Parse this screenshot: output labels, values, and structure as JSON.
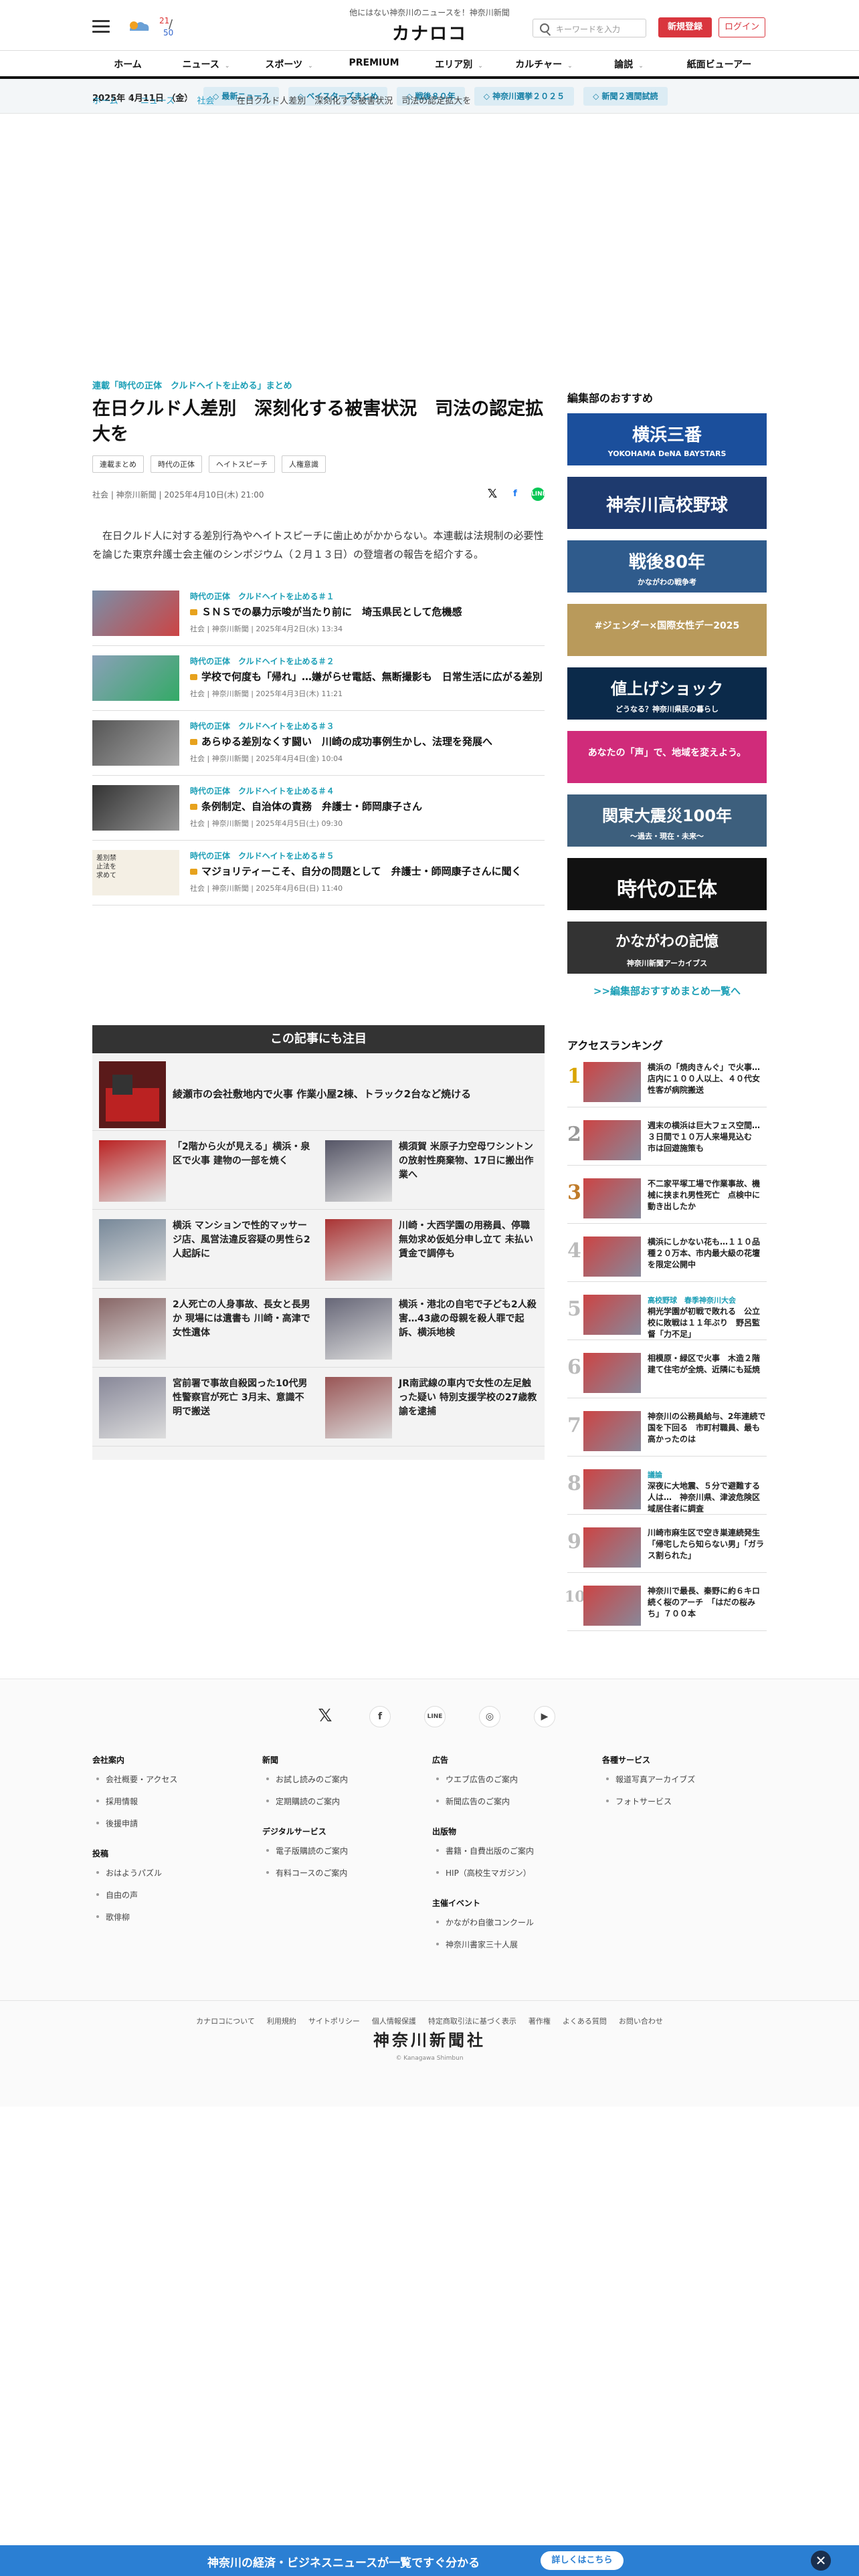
{
  "header": {
    "tagline": "他にはない神奈川のニュースを！神奈川新聞",
    "logo": "カナロコ",
    "weather": {
      "hi": "21",
      "lo": "50",
      "sep": "/"
    },
    "search_placeholder": "キーワードを入力",
    "register_label": "新規登録",
    "login_label": "ログイン"
  },
  "nav": {
    "items": [
      {
        "label": "ホーム",
        "dropdown": false
      },
      {
        "label": "ニュース",
        "dropdown": true
      },
      {
        "label": "スポーツ",
        "dropdown": true
      },
      {
        "label": "PREMIUM",
        "dropdown": false
      },
      {
        "label": "エリア別",
        "dropdown": true
      },
      {
        "label": "カルチャー",
        "dropdown": true
      },
      {
        "label": "論説",
        "dropdown": true
      },
      {
        "label": "紙面ビューアー",
        "dropdown": false
      }
    ]
  },
  "subbar": {
    "date": "2025年 4月11日 （金）",
    "pills": [
      "最新ニュース",
      "ベイスターズまとめ",
      "戦後８０年",
      "神奈川選挙２０２５",
      "新聞２週間試読"
    ]
  },
  "breadcrumb": {
    "home": "ホーム",
    "news": "ニュース",
    "category": "社会",
    "current": "在日クルド人差別　深刻化する被害状況　司法の認定拡大を"
  },
  "article": {
    "series": "連載「時代の正体　クルドヘイトを止める」まとめ",
    "title": "在日クルド人差別　深刻化する被害状況　司法の認定拡大を",
    "tags": [
      "連載まとめ",
      "時代の正体",
      "ヘイトスピーチ",
      "人権意識"
    ],
    "meta": "社会 | 神奈川新聞 | 2025年4月10日(木) 21:00",
    "share": {
      "x": "𝕏",
      "fb": "f",
      "line": "LINE"
    },
    "lead": "在日クルド人に対する差別行為やヘイトスピーチに歯止めがかからない。本連載は法規制の必要性を論じた東京弁護士会主催のシンポジウム（２月１３日）の登壇者の報告を紹介する。",
    "related": [
      {
        "series": "時代の正体　クルドヘイトを止める＃１",
        "title": "ＳＮＳでの暴力示唆が当たり前に　埼玉県民として危機感",
        "date": "社会 | 神奈川新聞 | 2025年4月2日(水) 13:34"
      },
      {
        "series": "時代の正体　クルドヘイトを止める＃２",
        "title": "学校で何度も「帰れ」…嫌がらせ電話、無断撮影も　日常生活に広がる差別",
        "date": "社会 | 神奈川新聞 | 2025年4月3日(木) 11:21"
      },
      {
        "series": "時代の正体　クルドヘイトを止める＃３",
        "title": "あらゆる差別なくす闘い　川崎の成功事例生かし、法理を発展へ",
        "date": "社会 | 神奈川新聞 | 2025年4月4日(金) 10:04"
      },
      {
        "series": "時代の正体　クルドヘイトを止める＃４",
        "title": "条例制定、自治体の責務　弁護士・師岡康子さん",
        "date": "社会 | 神奈川新聞 | 2025年4月5日(土) 09:30"
      },
      {
        "series": "時代の正体　クルドヘイトを止める＃５",
        "title": "マジョリティーこそ、自分の問題として　弁護士・師岡康子さんに聞く",
        "date": "社会 | 神奈川新聞 | 2025年4月6日(日) 11:40",
        "thumb_text": "差別禁止法を求めて"
      }
    ]
  },
  "notice": {
    "heading": "この記事にも注目",
    "top": "綾瀬市の会社敷地内で火事 作業小屋2棟、トラック2台など焼ける",
    "items": [
      "「2階から火が見える」横浜・泉区で火事 建物の一部を焼く",
      "横須賀 米原子力空母ワシントンの放射性廃棄物、17日に搬出作業へ",
      "横浜 マンションで性的マッサージ店、風営法違反容疑の男性ら2人起訴に",
      "川崎・大西学園の用務員、停職無効求め仮処分申し立て 未払い賃金で調停も",
      "2人死亡の人身事故、長女と長男か 現場には遺書も 川崎・高津で女性遺体",
      "横浜・港北の自宅で子ども2人殺害…43歳の母親を殺人罪で起訴、横浜地検",
      "宮前署で事故自殺図った10代男性警察官が死亡 3月末、意識不明で搬送",
      "JR南武線の車内で女性の左足触った疑い 特別支援学校の27歳教諭を逮捕"
    ]
  },
  "sidebar": {
    "heading": "編集部のおすすめ",
    "banners": [
      {
        "title": "横浜三番",
        "sub": "YOKOHAMA DeNA BAYSTARS"
      },
      {
        "title": "神奈川高校野球",
        "sub": ""
      },
      {
        "title": "戦後80年",
        "sub": "かながわの戦争考"
      },
      {
        "title": "#ジェンダー×国際女性デー2025",
        "sub": ""
      },
      {
        "title": "値上げショック",
        "sub": "どうなる？神奈川県民の暮らし"
      },
      {
        "title": "あなたの「声」で、地域を変えよう。",
        "sub": ""
      },
      {
        "title": "関東大震災100年",
        "sub": "～過去・現在・未来～"
      },
      {
        "title": "時代の正体",
        "sub": ""
      },
      {
        "title": "かながわの記憶",
        "sub": "神奈川新聞アーカイブス"
      }
    ],
    "more": ">>編集部おすすめまとめ一覧へ"
  },
  "ranking": {
    "heading": "アクセスランキング",
    "items": [
      {
        "num": "1",
        "text": "横浜の「焼肉きんぐ」で火事…店内に１００人以上、４０代女性客が病院搬送",
        "series": ""
      },
      {
        "num": "2",
        "text": "週末の横浜は巨大フェス空間…３日間で１０万人来場見込む　市は回遊施策も",
        "series": ""
      },
      {
        "num": "3",
        "text": "不二家平塚工場で作業事故、機械に挟まれ男性死亡　点検中に動き出したか",
        "series": ""
      },
      {
        "num": "4",
        "text": "横浜にしかない花も…１１０品種２０万本、市内最大級の花壇を限定公開中",
        "series": ""
      },
      {
        "num": "5",
        "text": "桐光学園が初戦で敗れる　公立校に敗戦は１１年ぶり　野呂監督「力不足」",
        "series": "高校野球　春季神奈川大会"
      },
      {
        "num": "6",
        "text": "相模原・緑区で火事　木造２階建て住宅が全焼、近隣にも延焼",
        "series": ""
      },
      {
        "num": "7",
        "text": "神奈川の公務員給与、2年連続で国を下回る　市町村職員、最も高かったのは",
        "series": ""
      },
      {
        "num": "8",
        "text": "深夜に大地震、５分で避難する人は…　神奈川県、津波危険区域居住者に調査",
        "series": "議論"
      },
      {
        "num": "9",
        "text": "川崎市麻生区で空き巣連続発生「帰宅したら知らない男」「ガラス割られた」",
        "series": ""
      },
      {
        "num": "10",
        "text": "神奈川で最長、秦野に約６キロ続く桜のアーチ　「はだの桜みち」７００本",
        "series": ""
      }
    ]
  },
  "footer": {
    "social": {
      "x": "𝕏",
      "fb": "f",
      "line": "LINE",
      "ig": "◎",
      "yt": "▶"
    },
    "cols": [
      {
        "sections": [
          {
            "h": "会社案内",
            "items": [
              "会社概要・アクセス",
              "採用情報",
              "後援申請"
            ]
          },
          {
            "h": "投稿",
            "items": [
              "おはようパズル",
              "自由の声",
              "歌俳柳"
            ]
          }
        ]
      },
      {
        "sections": [
          {
            "h": "新聞",
            "items": [
              "お試し読みのご案内",
              "定期購読のご案内"
            ]
          },
          {
            "h": "デジタルサービス",
            "items": [
              "電子版購読のご案内",
              "有料コースのご案内"
            ]
          }
        ]
      },
      {
        "sections": [
          {
            "h": "広告",
            "items": [
              "ウエブ広告のご案内",
              "新聞広告のご案内"
            ]
          },
          {
            "h": "出版物",
            "items": [
              "書籍・自費出版のご案内",
              "HIP（高校生マガジン）"
            ]
          },
          {
            "h": "主催イベント",
            "items": [
              "かながわ自徹コンクール",
              "神奈川書家三十人展"
            ]
          }
        ]
      },
      {
        "sections": [
          {
            "h": "各種サービス",
            "items": [
              "報道写真アーカイブズ",
              "フォトサービス"
            ]
          }
        ]
      }
    ],
    "links": [
      "カナロコについて",
      "利用規約",
      "サイトポリシー",
      "個人情報保護",
      "特定商取引法に基づく表示",
      "著作権",
      "よくある質問",
      "お問い合わせ"
    ],
    "logo": "神奈川新聞社",
    "logo_sub": "© Kanagawa Shimbun"
  },
  "bottombar": {
    "text": "神奈川の経済・ビジネスニュースが一覧ですぐ分かる",
    "button": "詳しくはこちら",
    "close": "✕"
  }
}
